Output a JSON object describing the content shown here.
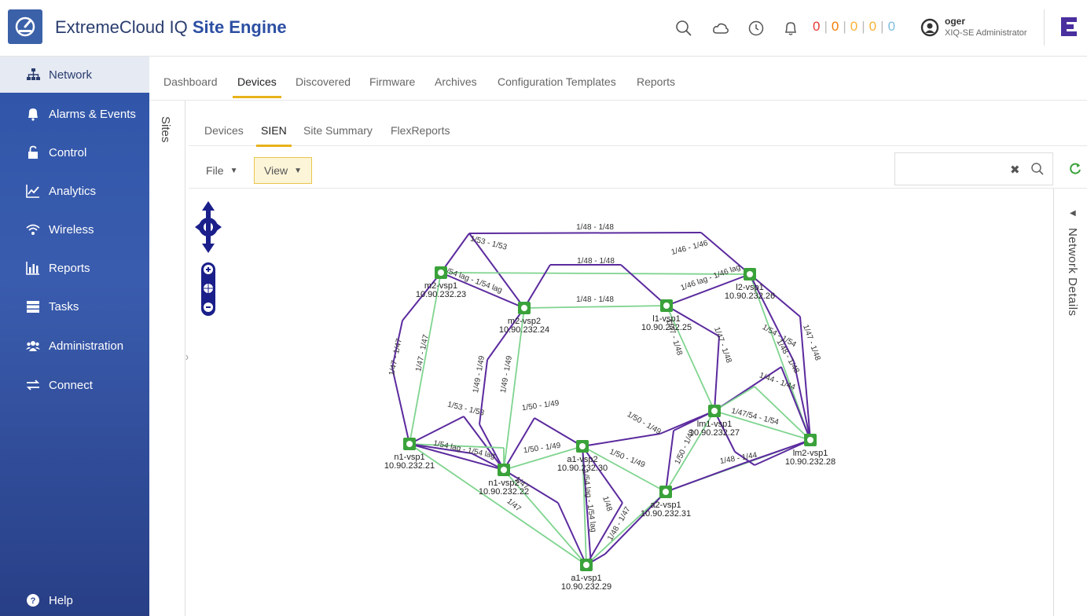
{
  "app": {
    "title_part1": "ExtremeCloud IQ ",
    "title_part2": "Site Engine"
  },
  "header": {
    "icons": [
      "search-icon",
      "cloud-icon",
      "clock-icon",
      "bell-icon"
    ],
    "status_counts": [
      "0",
      "0",
      "0",
      "0",
      "0"
    ],
    "user": {
      "name": "oger",
      "role": "XIQ-SE Administrator"
    },
    "colors": {
      "critical": "#e53935",
      "major": "#f57c00",
      "minor": "#f9b233",
      "info": "#7dbbe0"
    }
  },
  "sidebar": {
    "items": [
      {
        "label": "Network",
        "icon": "network-icon",
        "active": true
      },
      {
        "label": "Alarms & Events",
        "icon": "bell-icon"
      },
      {
        "label": "Control",
        "icon": "lock-icon"
      },
      {
        "label": "Analytics",
        "icon": "chart-icon"
      },
      {
        "label": "Wireless",
        "icon": "wifi-icon"
      },
      {
        "label": "Reports",
        "icon": "bar-chart-icon"
      },
      {
        "label": "Tasks",
        "icon": "tasks-icon"
      },
      {
        "label": "Administration",
        "icon": "users-icon"
      },
      {
        "label": "Connect",
        "icon": "arrows-icon"
      }
    ],
    "help": "Help"
  },
  "sites_label": "Sites",
  "main_tabs": [
    "Dashboard",
    "Devices",
    "Discovered",
    "Firmware",
    "Archives",
    "Configuration Templates",
    "Reports"
  ],
  "main_tab_active": "Devices",
  "sub_tabs": [
    "Devices",
    "SIEN",
    "Site Summary",
    "FlexReports"
  ],
  "sub_tab_active": "SIEN",
  "toolbar": {
    "file_label": "File",
    "view_label": "View",
    "search_value": "",
    "search_placeholder": ""
  },
  "details_label": "Network Details",
  "topology": {
    "nodes": [
      {
        "name": "m2-vsp1",
        "ip": "10.90.232.23"
      },
      {
        "name": "m2-vsp2",
        "ip": "10.90.232.24"
      },
      {
        "name": "l1-vsp1",
        "ip": "10.90.232.25"
      },
      {
        "name": "l2-vsp1",
        "ip": "10.90.232.26"
      },
      {
        "name": "n1-vsp1",
        "ip": "10.90.232.21"
      },
      {
        "name": "n1-vsp2",
        "ip": "10.90.232.22"
      },
      {
        "name": "a1-vsp2",
        "ip": "10.90.232.30"
      },
      {
        "name": "lm1-vsp1",
        "ip": "10.90.232.27"
      },
      {
        "name": "lm2-vsp1",
        "ip": "10.90.232.28"
      },
      {
        "name": "a2-vsp1",
        "ip": "10.90.232.31"
      },
      {
        "name": "a1-vsp1",
        "ip": "10.90.232.29"
      }
    ],
    "link_labels": [
      "1/48 - 1/48",
      "1/53 - 1/53",
      "1/46 - 1/46",
      "1/48 - 1/48",
      "1/54 lag - 1/54 lag",
      "1/46 lag - 1/46 lag",
      "1/48 - 1/48",
      "1/47 - 1/47",
      "1/47 - 1/47",
      "1/47 - 1/48",
      "1/47 - 1/48",
      "1/47 - 1/48",
      "1/54 - 1/54",
      "1/49 - 1/49",
      "1/49 - 1/49",
      "1/44 - 1/44",
      "1/48 - 1/48",
      "1/53 - 1/53",
      "1/50 - 1/49",
      "1/50 - 1/49",
      "1/47/54 - 1/54",
      "1/54 lag - 1/54 lag",
      "1/50 - 1/49",
      "1/50 - 1/49",
      "1/50 - 1/49",
      "1/48 - 1/44",
      "1/54 lag - 1/54 lag",
      "1/47",
      "1/47",
      "1/48 - 1/47",
      "1/48"
    ],
    "colors": {
      "isis_link": "#5b2a9e",
      "lag_link": "#7fd48f",
      "node": "#3aa23a"
    }
  }
}
